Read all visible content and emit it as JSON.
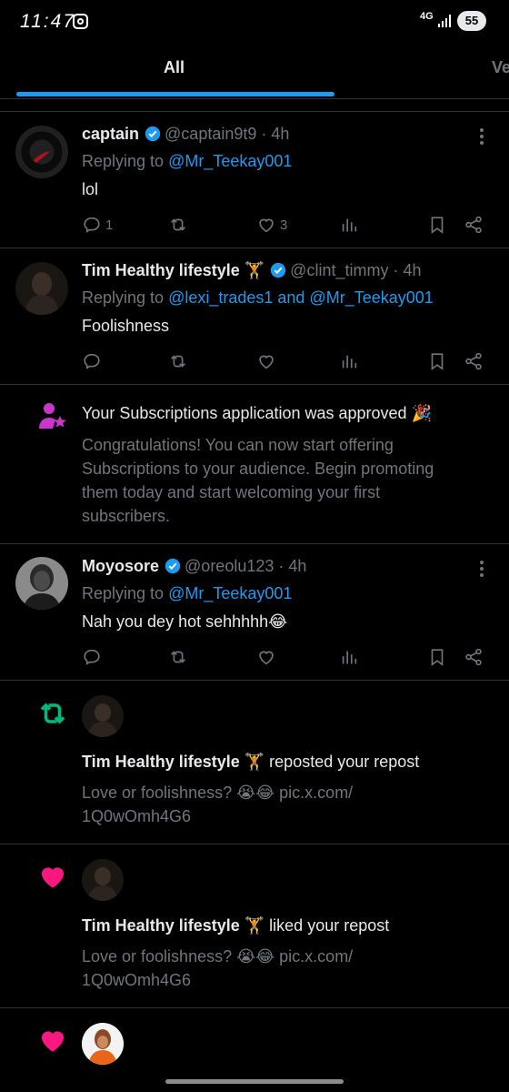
{
  "status_bar": {
    "time": "11:47",
    "network": "4G",
    "battery": "55"
  },
  "tabs": {
    "active": "All",
    "next": "Ve"
  },
  "items": [
    {
      "type": "reply",
      "name": "captain",
      "handle": "@captain9t9",
      "time": "· 4h",
      "replying_prefix": "Replying to ",
      "replying_to": "@Mr_Teekay001",
      "text": "lol",
      "reply_count": "1",
      "like_count": "3"
    },
    {
      "type": "reply",
      "name": "Tim Healthy lifestyle",
      "name_emoji": "🏋",
      "handle": "@clint_timmy",
      "time": "· 4h",
      "replying_prefix": "Replying to ",
      "replying_to": "@lexi_trades1 and @Mr_Teekay001",
      "text": "Foolishness",
      "reply_count": "",
      "like_count": ""
    },
    {
      "type": "notice",
      "title": "Your Subscriptions application was approved",
      "title_emoji": "🎉",
      "lines": [
        "Congratulations! You can now start offering",
        "Subscriptions to your audience. Begin promoting",
        "them today and start welcoming your first",
        "subscribers."
      ]
    },
    {
      "type": "reply",
      "name": "Moyosore",
      "handle": "@oreolu123",
      "time": "· 4h",
      "replying_prefix": "Replying to ",
      "replying_to": "@Mr_Teekay001",
      "text": "Nah you dey hot sehhhhh",
      "text_emoji": "😂",
      "reply_count": "",
      "like_count": ""
    },
    {
      "type": "repost_notice",
      "name": "Tim Healthy lifestyle",
      "name_emoji": "🏋",
      "action": " reposted your repost",
      "line1": "Love or foolishness? 😭😂 pic.x.com/",
      "line2": "1Q0wOmh4G6"
    },
    {
      "type": "like_notice",
      "name": "Tim Healthy lifestyle",
      "name_emoji": "🏋",
      "action": " liked your repost",
      "line1": "Love or foolishness? 😭😂 pic.x.com/",
      "line2": "1Q0wOmh4G6"
    }
  ],
  "colors": {
    "background": "#000000",
    "accent": "#1d9bf0",
    "muted": "#71767b",
    "repost": "#00ba7c",
    "like": "#f91880",
    "subscription": "#c936cc"
  }
}
